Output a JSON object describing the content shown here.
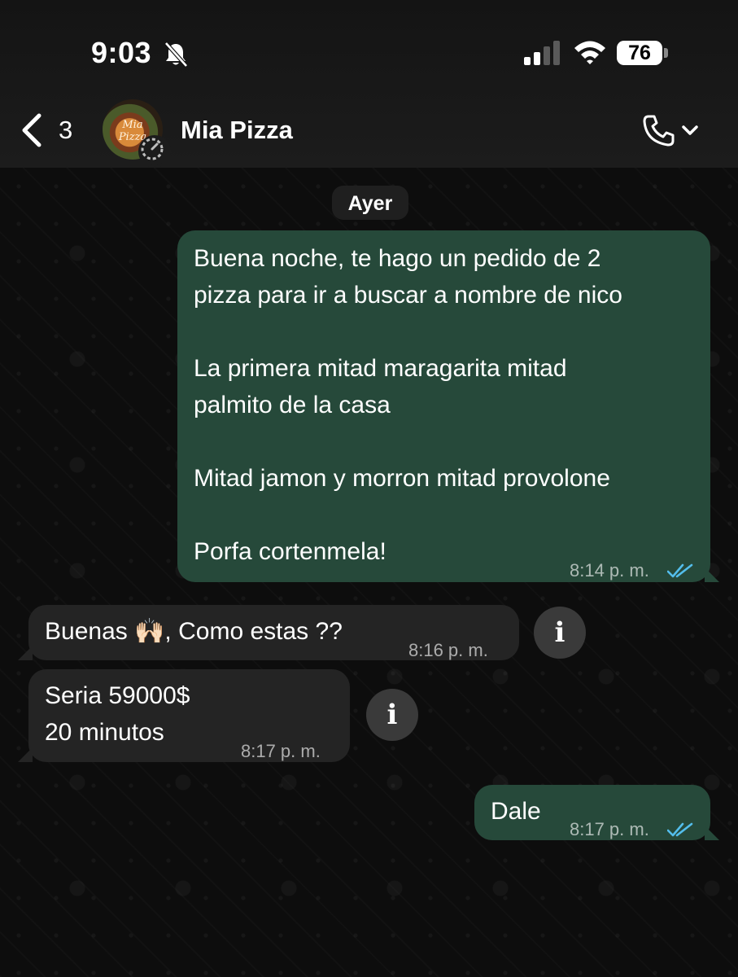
{
  "status_bar": {
    "time": "9:03",
    "battery": "76",
    "icons": [
      "bell-slash-icon",
      "cellular-signal-icon",
      "wifi-icon",
      "battery-icon"
    ]
  },
  "header": {
    "back_count": "3",
    "contact_name": "Mia Pizza",
    "avatar_text": "Mia Pizza",
    "icons": [
      "chevron-left-icon",
      "status-ring-icon",
      "phone-icon",
      "chevron-down-icon"
    ]
  },
  "chat": {
    "day_label": "Ayer",
    "messages": [
      {
        "direction": "outgoing",
        "text": "Buena noche, te hago un pedido de 2\npizza para ir a buscar a nombre de nico\n\nLa primera mitad maragarita mitad\npalmito de la casa\n\nMitad jamon y morron mitad provolone\n\nPorfa cortenmela!",
        "time": "8:14 p. m.",
        "status": "read"
      },
      {
        "direction": "incoming",
        "text": "Buenas 🙌🏻, Como estas ??",
        "time": "8:16 p. m."
      },
      {
        "direction": "incoming",
        "text": "Seria 59000$\n20 minutos",
        "time": "8:17 p. m."
      },
      {
        "direction": "outgoing",
        "text": "Dale",
        "time": "8:17 p. m.",
        "status": "read"
      }
    ],
    "info_label": "i"
  },
  "colors": {
    "outgoing_bubble": "#26493a",
    "incoming_bubble": "#242424",
    "read_ticks": "#53bdeb",
    "background": "#0d0d0d"
  }
}
